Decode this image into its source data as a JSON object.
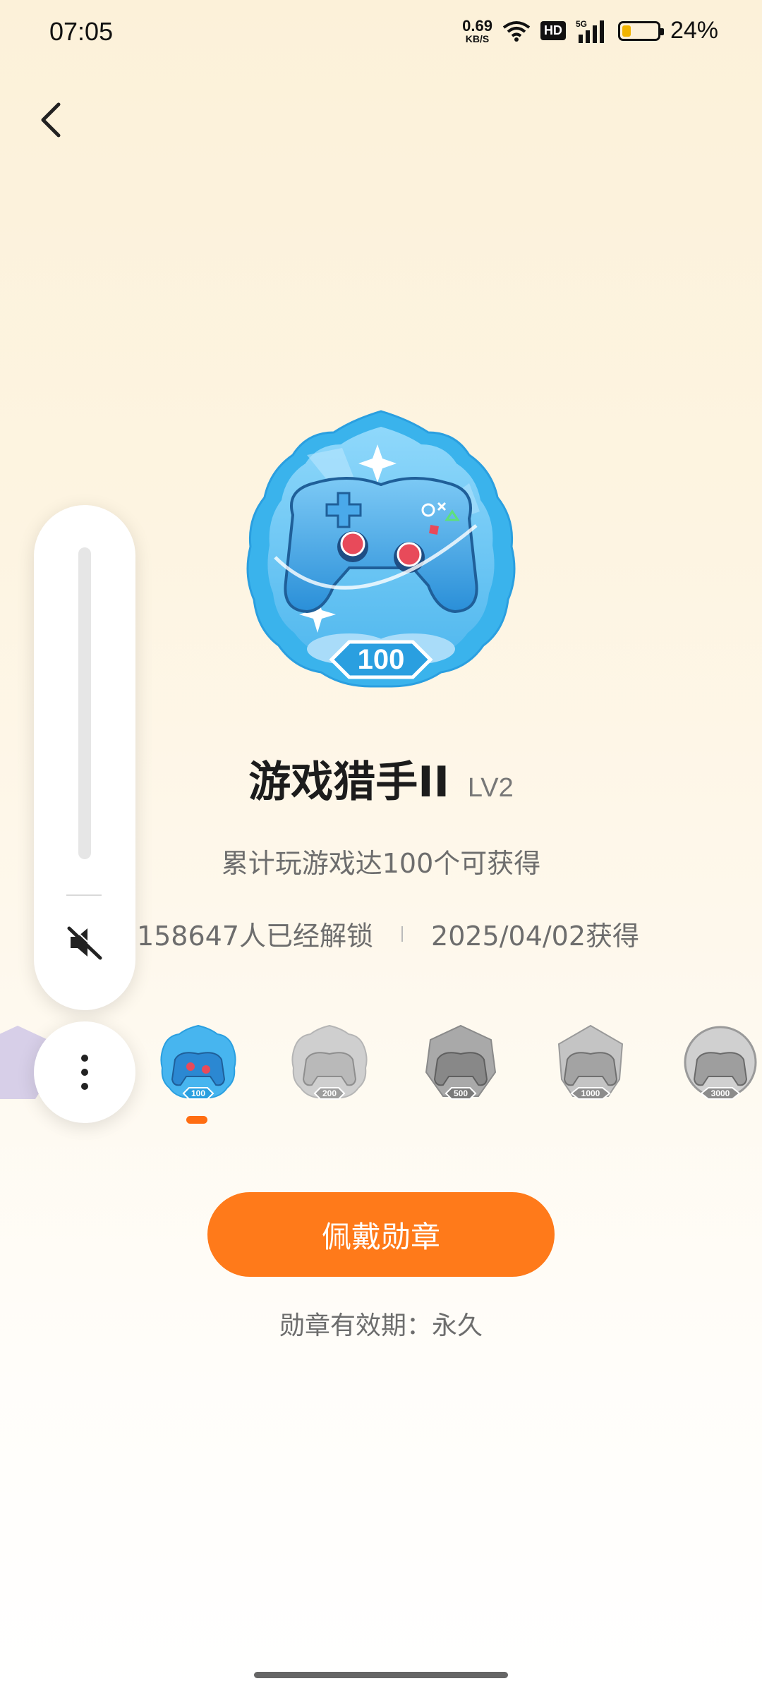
{
  "status_bar": {
    "time": "07:05",
    "net_speed_value": "0.69",
    "net_speed_unit": "KB/S",
    "hd": "HD",
    "network": "5G",
    "battery_percent": "24%",
    "battery_level": 0.24,
    "icons": [
      "wifi-icon",
      "signal-icon",
      "battery-icon"
    ]
  },
  "nav": {
    "back_icon": "chevron-left-icon"
  },
  "badge": {
    "icon": "game-controller-badge",
    "ribbon_number": "100",
    "title": "游戏猎手II",
    "level": "LV2",
    "description": "累计玩游戏达100个可获得",
    "unlock_count": "158647人已经解锁",
    "obtained_date": "2025/04/02获得"
  },
  "levels": [
    {
      "label": "100",
      "state": "active"
    },
    {
      "label": "200",
      "state": "locked"
    },
    {
      "label": "500",
      "state": "locked"
    },
    {
      "label": "1000",
      "state": "locked"
    },
    {
      "label": "3000",
      "state": "locked"
    }
  ],
  "actions": {
    "wear_button": "佩戴勋章",
    "validity": "勋章有效期：永久"
  },
  "overlay": {
    "mute_icon": "volume-mute-icon",
    "more_icon": "more-vertical-icon"
  },
  "colors": {
    "accent": "#ff7a1a",
    "badge_blue": "#3cb4ee",
    "locked_grey": "#a8a8a8"
  }
}
